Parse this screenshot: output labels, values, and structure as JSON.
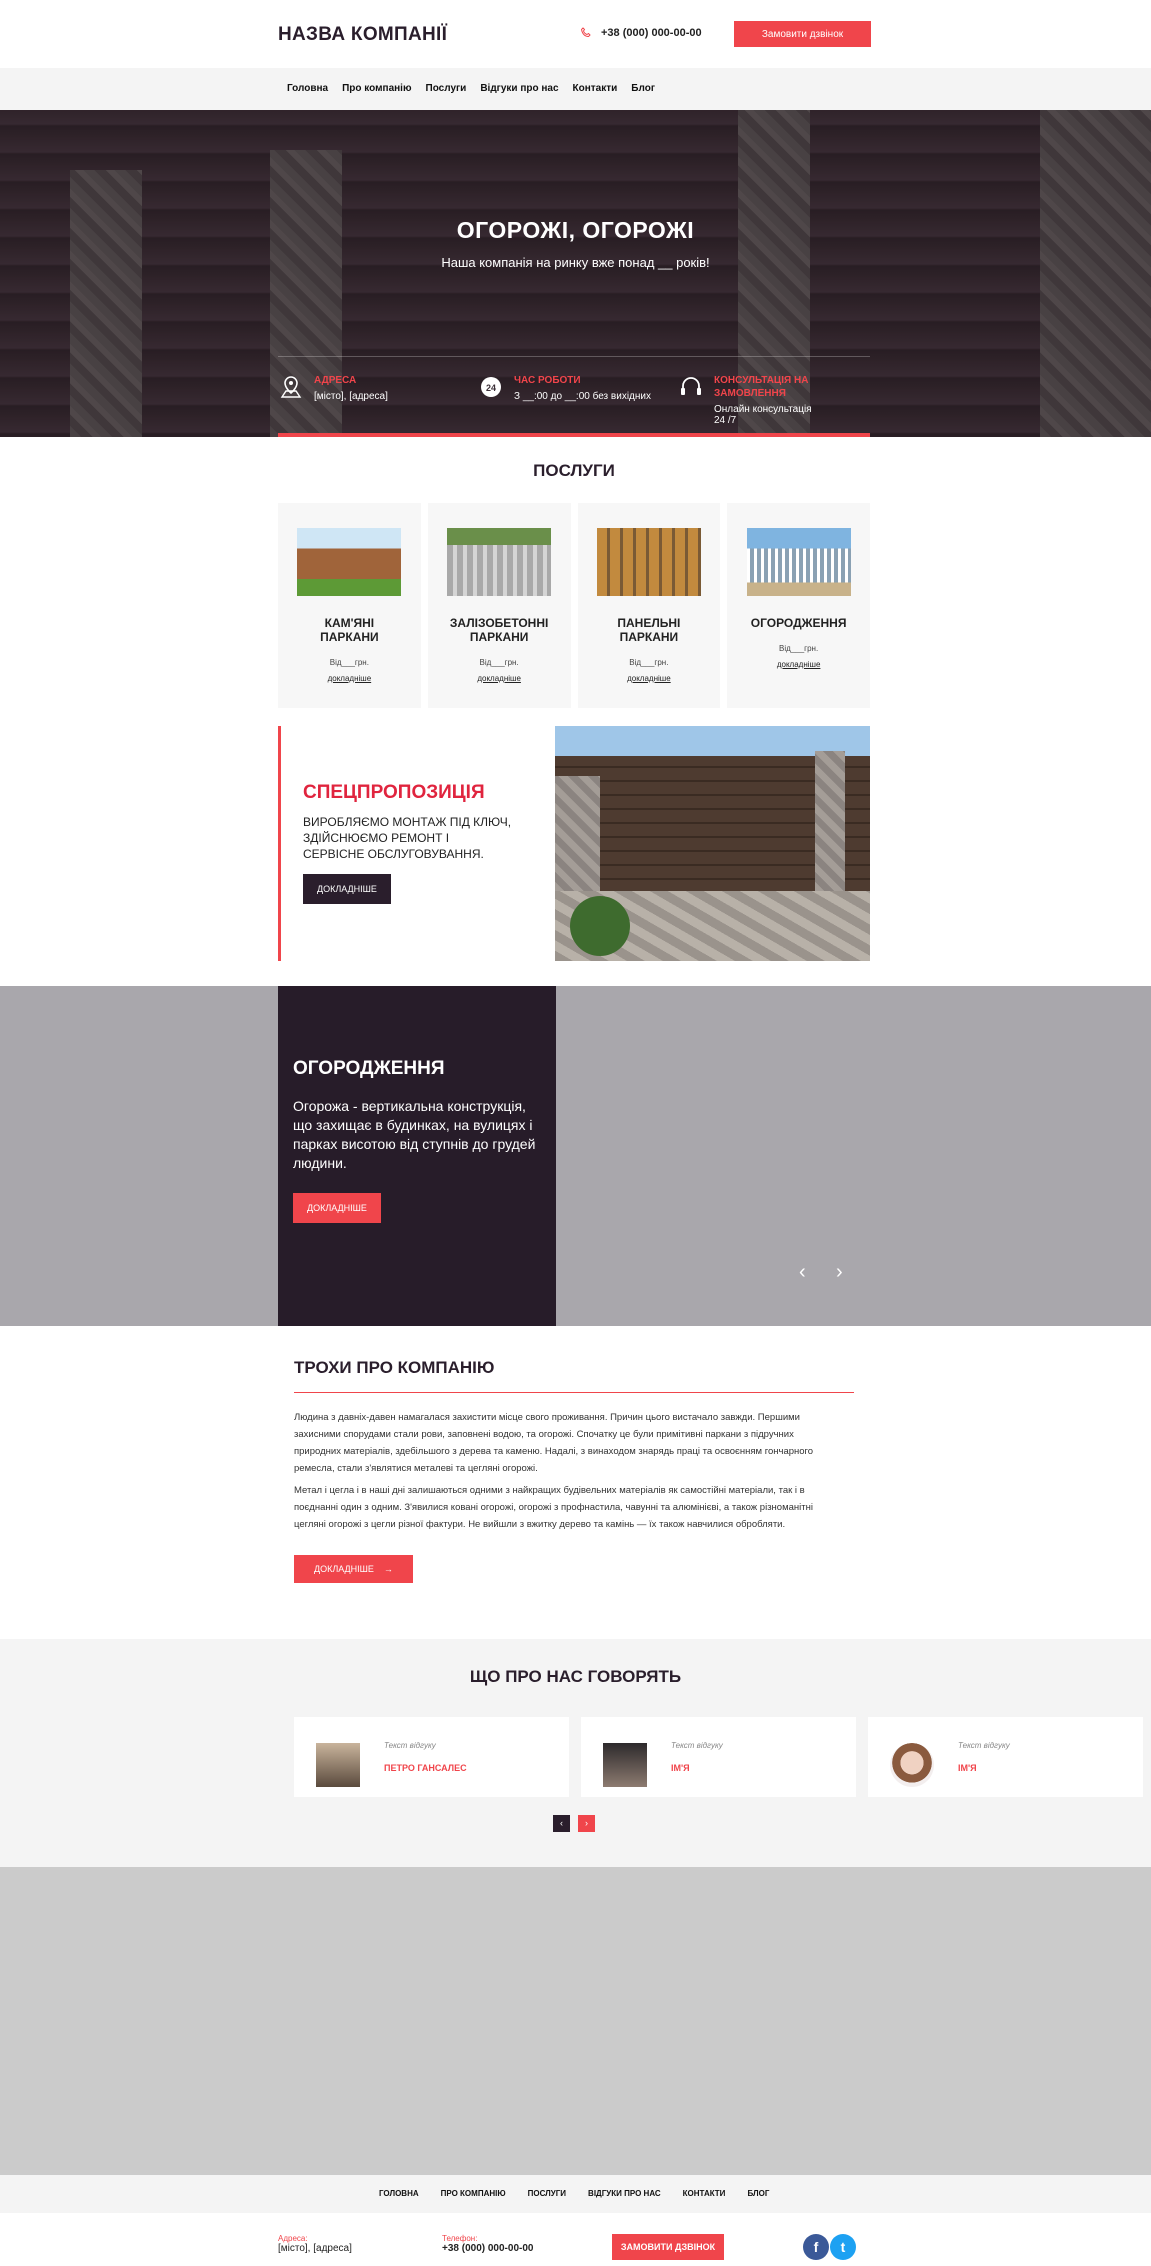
{
  "header": {
    "logo": "НАЗВА КОМПАНІЇ",
    "phone": "+38 (000) 000-00-00",
    "callback_button": "Замовити дзвінок"
  },
  "nav": [
    "Головна",
    "Про компанію",
    "Послуги",
    "Відгуки про нас",
    "Контакти",
    "Блог"
  ],
  "hero": {
    "title": "ОГОРОЖІ, ОГОРОЖІ",
    "subtitle": "Наша компанія на ринку вже понад __ років!",
    "info": [
      {
        "icon": "map-pin-icon",
        "title": "АДРЕСА",
        "value": "[місто], [адреса]"
      },
      {
        "icon": "clock-24-icon",
        "title": "ЧАС РОБОТИ",
        "value": "З __:00 до __:00 без вихідних"
      },
      {
        "icon": "headset-icon",
        "title": "КОНСУЛЬТАЦІЯ НА ЗАМОВЛЕННЯ",
        "value": "Онлайн консультація 24 /7"
      }
    ]
  },
  "services": {
    "title": "ПОСЛУГИ",
    "items": [
      {
        "name": "КАМ'ЯНІ ПАРКАНИ",
        "price": "Від___грн.",
        "more": "докладніше"
      },
      {
        "name": "ЗАЛІЗОБЕТОННІ ПАРКАНИ",
        "price": "Від___грн.",
        "more": "докладніше"
      },
      {
        "name": "ПАНЕЛЬНІ ПАРКАНИ",
        "price": "Від___грн.",
        "more": "докладніше"
      },
      {
        "name": "ОГОРОДЖЕННЯ",
        "price": "Від___грн.",
        "more": "докладніше"
      }
    ]
  },
  "offer": {
    "title": "СПЕЦПРОПОЗИЦІЯ",
    "text": "ВИРОБЛЯЄМО МОНТАЖ ПІД КЛЮЧ, ЗДІЙСНЮЄМО РЕМОНТ І СЕРВІСНЕ ОБСЛУГОВУВАННЯ.",
    "button": "ДОКЛАДНІШЕ"
  },
  "slider": {
    "title": "ОГОРОДЖЕННЯ",
    "text": "Огорожа - вертикальна конструкція, що захищає в будинках, на вулицях і парках висотою від ступнів до грудей людини.",
    "button": "ДОКЛАДНІШЕ",
    "prev": "‹",
    "next": "›"
  },
  "about": {
    "title": "ТРОХИ ПРО КОМПАНІЮ",
    "p1": "Людина з давніх-давен намагалася захистити місце свого проживання. Причин цього вистачало завжди. Першими захисними спорудами стали рови, заповнені водою, та огорожі. Спочатку це були примітивні паркани з підручних природних матеріалів, здебільшого з дерева та каменю. Надалі, з винаходом знарядь праці та освоєнням гончарного ремесла, стали з'являтися металеві та цегляні огорожі.",
    "p2": "Метал і цегла і в наші дні залишаються одними з найкращих будівельних матеріалів як самостійні матеріали, так і в поєднанні один з одним. З'явилися ковані огорожі, огорожі з профнастила, чавунні та алюмінієві, а також різноманітні цегляні огорожі з цегли різної фактури. Не вийшли з вжитку дерево та камінь — їх також навчилися обробляти.",
    "button": "ДОКЛАДНІШЕ"
  },
  "reviews": {
    "title": "ЩО ПРО НАС ГОВОРЯТЬ",
    "items": [
      {
        "text": "Текст відгуку",
        "name": "ПЕТРО ГАНСАЛЕС"
      },
      {
        "text": "Текст відгуку",
        "name": "ІМ'Я"
      },
      {
        "text": "Текст відгуку",
        "name": "ІМ'Я"
      }
    ],
    "prev": "‹",
    "next": "›"
  },
  "footer": {
    "nav": [
      "ГОЛОВНА",
      "ПРО КОМПАНІЮ",
      "ПОСЛУГИ",
      "ВІДГУКИ ПРО НАС",
      "КОНТАКТИ",
      "БЛОГ"
    ],
    "address_label": "Адреса:",
    "address": "[місто], [адреса]",
    "phone_label": "Телефон:",
    "phone": "+38 (000) 000-00-00",
    "callback_button": "ЗАМОВИТИ ДЗВІНОК",
    "social": [
      {
        "icon": "facebook-icon",
        "glyph": "f",
        "color": "#3b5998"
      },
      {
        "icon": "twitter-icon",
        "glyph": "t",
        "color": "#1da1f2"
      }
    ]
  },
  "colors": {
    "accent": "#f0454b",
    "dark": "#2a1e2c",
    "slider_bg": "#a9a7ac",
    "light_bg": "#f4f4f4"
  }
}
